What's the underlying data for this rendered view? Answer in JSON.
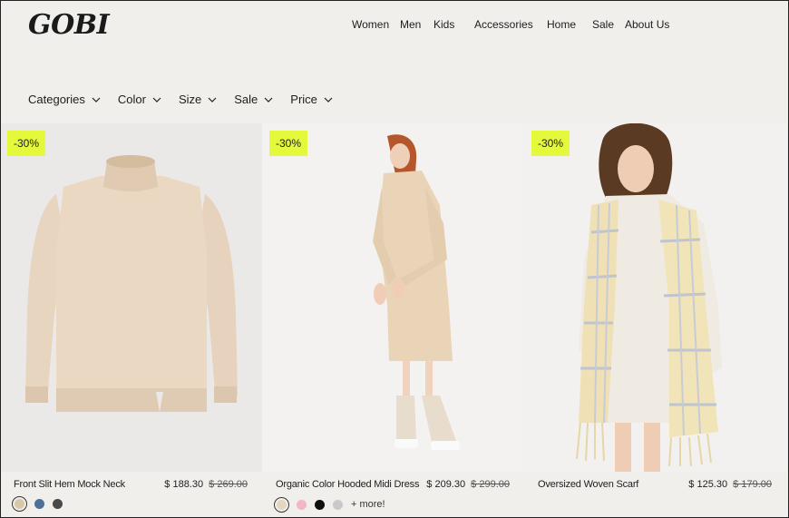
{
  "brand": {
    "logo": "GOBI"
  },
  "nav": [
    "Women",
    "Men",
    "Kids",
    "Accessories",
    "Home",
    "Sale",
    "About Us"
  ],
  "filters": [
    "Categories",
    "Color",
    "Size",
    "Sale",
    "Price"
  ],
  "icons": {
    "filter_chevron": "chevron-down-icon"
  },
  "colors": {
    "badge": "#e4f83c",
    "background": "#f0efec"
  },
  "products": [
    {
      "badge": "-30%",
      "name": "Front Slit Hem Mock Neck",
      "price": "$ 188.30",
      "old_price": "$ 269.00",
      "swatches": [
        "#d9c8a8",
        "#4f6f99",
        "#4a4a4a"
      ],
      "more": ""
    },
    {
      "badge": "-30%",
      "name": "Organic Color Hooded Midi Dress",
      "price": "$ 209.30",
      "old_price": "$ 299.00",
      "swatches": [
        "#e6d6bf",
        "#f2b6c4",
        "#0e0e0e",
        "#c9c9c9"
      ],
      "more": "+ more!"
    },
    {
      "badge": "-30%",
      "name": "Oversized Woven Scarf",
      "price": "$ 125.30",
      "old_price": "$ 179.00",
      "swatches": [],
      "more": ""
    }
  ]
}
